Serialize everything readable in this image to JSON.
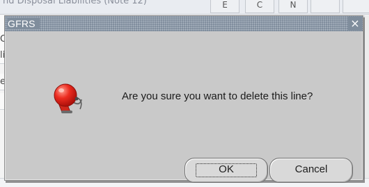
{
  "background": {
    "header_text": "nd Disposal Liabilities (Note 12)",
    "column_buttons": [
      "E",
      "C",
      "N",
      "",
      ""
    ],
    "row_markers": [
      "",
      "C",
      "li",
      "e",
      ""
    ]
  },
  "dialog": {
    "title": "GFRS",
    "close_glyph": "×",
    "icon": "alarm-bell-icon",
    "message": "Are you sure you want to delete this line?",
    "ok_label": "OK",
    "cancel_label": "Cancel"
  },
  "colors": {
    "titlebar": "#7f8d9c",
    "dialog_bg": "#c9c9c9",
    "bell_red": "#e2231a"
  }
}
